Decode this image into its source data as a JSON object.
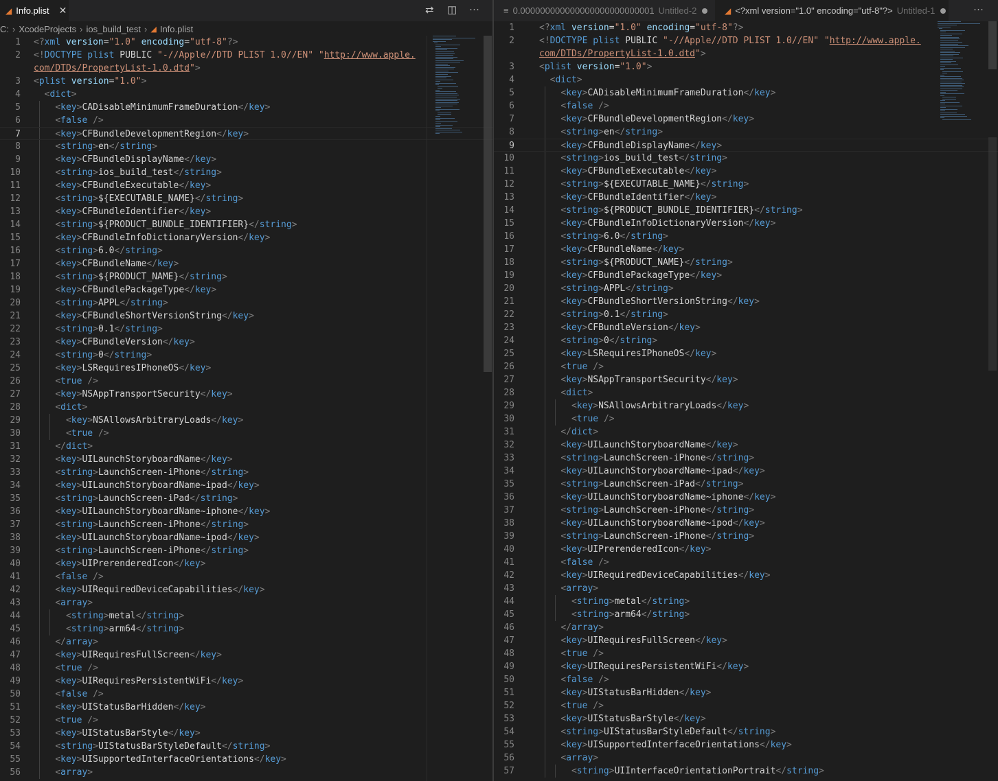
{
  "left": {
    "tab": {
      "title": "Info.plist",
      "close_icon": "✕"
    },
    "actions": {
      "compare": "⇄",
      "split": "◫",
      "more": "···"
    },
    "breadcrumb": {
      "root": "C:",
      "folder1": "XcodeProjects",
      "folder2": "ios_build_test",
      "file": "Info.plist"
    },
    "cursor_line": 7,
    "lines": [
      "<?xml version=\"1.0\" encoding=\"utf-8\"?>",
      "<!DOCTYPE plist PUBLIC \"-//Apple//DTD PLIST 1.0//EN\" \"http://www.apple.",
      "com/DTDs/PropertyList-1.0.dtd\">",
      "<plist version=\"1.0\">",
      "  <dict>",
      "    <key>CADisableMinimumFrameDuration</key>",
      "    <false />",
      "    <key>CFBundleDevelopmentRegion</key>",
      "    <string>en</string>",
      "    <key>CFBundleDisplayName</key>",
      "    <string>ios_build_test</string>",
      "    <key>CFBundleExecutable</key>",
      "    <string>${EXECUTABLE_NAME}</string>",
      "    <key>CFBundleIdentifier</key>",
      "    <string>${PRODUCT_BUNDLE_IDENTIFIER}</string>",
      "    <key>CFBundleInfoDictionaryVersion</key>",
      "    <string>6.0</string>",
      "    <key>CFBundleName</key>",
      "    <string>${PRODUCT_NAME}</string>",
      "    <key>CFBundlePackageType</key>",
      "    <string>APPL</string>",
      "    <key>CFBundleShortVersionString</key>",
      "    <string>0.1</string>",
      "    <key>CFBundleVersion</key>",
      "    <string>0</string>",
      "    <key>LSRequiresIPhoneOS</key>",
      "    <true />",
      "    <key>NSAppTransportSecurity</key>",
      "    <dict>",
      "      <key>NSAllowsArbitraryLoads</key>",
      "      <true />",
      "    </dict>",
      "    <key>UILaunchStoryboardName</key>",
      "    <string>LaunchScreen-iPhone</string>",
      "    <key>UILaunchStoryboardName~ipad</key>",
      "    <string>LaunchScreen-iPad</string>",
      "    <key>UILaunchStoryboardName~iphone</key>",
      "    <string>LaunchScreen-iPhone</string>",
      "    <key>UILaunchStoryboardName~ipod</key>",
      "    <string>LaunchScreen-iPhone</string>",
      "    <key>UIPrerenderedIcon</key>",
      "    <false />",
      "    <key>UIRequiredDeviceCapabilities</key>",
      "    <array>",
      "      <string>metal</string>",
      "      <string>arm64</string>",
      "    </array>",
      "    <key>UIRequiresFullScreen</key>",
      "    <true />",
      "    <key>UIRequiresPersistentWiFi</key>",
      "    <false />",
      "    <key>UIStatusBarHidden</key>",
      "    <true />",
      "    <key>UIStatusBarStyle</key>",
      "    <string>UIStatusBarStyleDefault</string>",
      "    <key>UISupportedInterfaceOrientations</key>",
      "    <array>"
    ],
    "line_numbers": [
      "1",
      "2",
      "",
      "3",
      "4",
      "5",
      "6",
      "7",
      "8",
      "9",
      "10",
      "11",
      "12",
      "13",
      "14",
      "15",
      "16",
      "17",
      "18",
      "19",
      "20",
      "21",
      "22",
      "23",
      "24",
      "25",
      "26",
      "27",
      "28",
      "29",
      "30",
      "31",
      "32",
      "33",
      "34",
      "35",
      "36",
      "37",
      "38",
      "39",
      "40",
      "41",
      "42",
      "43",
      "44",
      "45",
      "46",
      "47",
      "48",
      "49",
      "50",
      "51",
      "52",
      "53",
      "54",
      "55",
      "56"
    ]
  },
  "right": {
    "tabs": [
      {
        "title": "0.000000000000000000000000001",
        "suffix": "Untitled-2"
      },
      {
        "title": "<?xml version=\"1.0\" encoding=\"utf-8\"?>",
        "suffix": "Untitled-1"
      }
    ],
    "actions": {
      "more": "···"
    },
    "cursor_line": 9,
    "lines": [
      "<?xml version=\"1.0\" encoding=\"utf-8\"?>",
      "<!DOCTYPE plist PUBLIC \"-//Apple//DTD PLIST 1.0//EN\" \"http://www.apple.",
      "com/DTDs/PropertyList-1.0.dtd\">",
      "<plist version=\"1.0\">",
      "  <dict>",
      "    <key>CADisableMinimumFrameDuration</key>",
      "    <false />",
      "    <key>CFBundleDevelopmentRegion</key>",
      "    <string>en</string>",
      "    <key>CFBundleDisplayName</key>",
      "    <string>ios_build_test</string>",
      "    <key>CFBundleExecutable</key>",
      "    <string>${EXECUTABLE_NAME}</string>",
      "    <key>CFBundleIdentifier</key>",
      "    <string>${PRODUCT_BUNDLE_IDENTIFIER}</string>",
      "    <key>CFBundleInfoDictionaryVersion</key>",
      "    <string>6.0</string>",
      "    <key>CFBundleName</key>",
      "    <string>${PRODUCT_NAME}</string>",
      "    <key>CFBundlePackageType</key>",
      "    <string>APPL</string>",
      "    <key>CFBundleShortVersionString</key>",
      "    <string>0.1</string>",
      "    <key>CFBundleVersion</key>",
      "    <string>0</string>",
      "    <key>LSRequiresIPhoneOS</key>",
      "    <true />",
      "    <key>NSAppTransportSecurity</key>",
      "    <dict>",
      "      <key>NSAllowsArbitraryLoads</key>",
      "      <true />",
      "    </dict>",
      "    <key>UILaunchStoryboardName</key>",
      "    <string>LaunchScreen-iPhone</string>",
      "    <key>UILaunchStoryboardName~ipad</key>",
      "    <string>LaunchScreen-iPad</string>",
      "    <key>UILaunchStoryboardName~iphone</key>",
      "    <string>LaunchScreen-iPhone</string>",
      "    <key>UILaunchStoryboardName~ipod</key>",
      "    <string>LaunchScreen-iPhone</string>",
      "    <key>UIPrerenderedIcon</key>",
      "    <false />",
      "    <key>UIRequiredDeviceCapabilities</key>",
      "    <array>",
      "      <string>metal</string>",
      "      <string>arm64</string>",
      "    </array>",
      "    <key>UIRequiresFullScreen</key>",
      "    <true />",
      "    <key>UIRequiresPersistentWiFi</key>",
      "    <false />",
      "    <key>UIStatusBarHidden</key>",
      "    <true />",
      "    <key>UIStatusBarStyle</key>",
      "    <string>UIStatusBarStyleDefault</string>",
      "    <key>UISupportedInterfaceOrientations</key>",
      "    <array>",
      "      <string>UIInterfaceOrientationPortrait</string>"
    ],
    "line_numbers": [
      "1",
      "2",
      "",
      "3",
      "4",
      "5",
      "6",
      "7",
      "8",
      "9",
      "10",
      "11",
      "12",
      "13",
      "14",
      "15",
      "16",
      "17",
      "18",
      "19",
      "20",
      "21",
      "22",
      "23",
      "24",
      "25",
      "26",
      "27",
      "28",
      "29",
      "30",
      "31",
      "32",
      "33",
      "34",
      "35",
      "36",
      "37",
      "38",
      "39",
      "40",
      "41",
      "42",
      "43",
      "44",
      "45",
      "46",
      "47",
      "48",
      "49",
      "50",
      "51",
      "52",
      "53",
      "54",
      "55",
      "56",
      "57"
    ]
  },
  "colors": {
    "bracket": "#808080",
    "tag": "#569cd6",
    "attr": "#9cdcfe",
    "value": "#ce9178",
    "text": "#d4d4d4"
  }
}
